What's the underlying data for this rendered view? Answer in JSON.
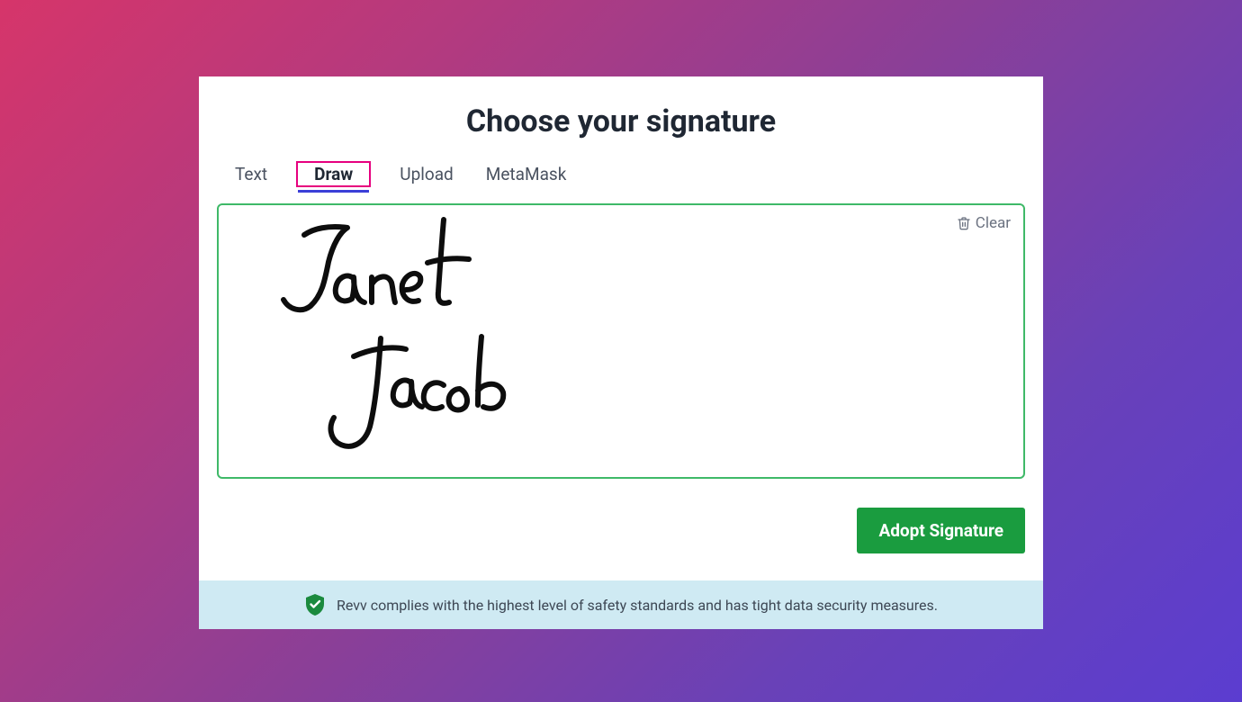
{
  "title": "Choose your signature",
  "tabs": {
    "text": "Text",
    "draw": "Draw",
    "upload": "Upload",
    "metamask": "MetaMask",
    "active": "draw"
  },
  "canvas": {
    "clear_label": "Clear",
    "signature_name": "Janet Jacob"
  },
  "actions": {
    "adopt_label": "Adopt Signature"
  },
  "footer": {
    "message": "Revv complies with the highest level of safety standards and has tight data security measures."
  },
  "colors": {
    "canvas_border": "#3fb968",
    "active_tab_border": "#e6007e",
    "active_tab_underline": "#3b3fd8",
    "adopt_button": "#1a9c3f",
    "footer_bg": "#cfeaf3",
    "shield": "#1b8a3e"
  }
}
